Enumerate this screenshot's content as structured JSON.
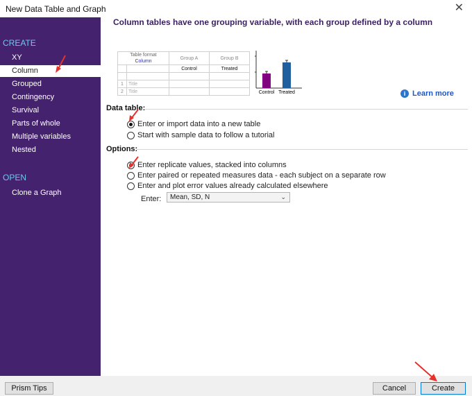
{
  "window": {
    "title": "New Data Table and Graph",
    "close_glyph": "✕"
  },
  "sidebar": {
    "create_header": "CREATE",
    "create_items": [
      {
        "label": "XY"
      },
      {
        "label": "Column"
      },
      {
        "label": "Grouped"
      },
      {
        "label": "Contingency"
      },
      {
        "label": "Survival"
      },
      {
        "label": "Parts of whole"
      },
      {
        "label": "Multiple variables"
      },
      {
        "label": "Nested"
      }
    ],
    "selected_item": "Column",
    "open_header": "OPEN",
    "open_items": [
      {
        "label": "Clone a Graph"
      }
    ]
  },
  "main": {
    "heading": "Column tables have one grouping variable, with each group defined by a column",
    "format_table": {
      "format_label": "Table format",
      "format_value": "Column",
      "group_a_label": "Group A",
      "group_a_name": "Control",
      "group_b_label": "Group B",
      "group_b_name": "Treated",
      "rows": [
        {
          "num": "1",
          "title": "Title"
        },
        {
          "num": "2",
          "title": "Title"
        }
      ]
    },
    "preview_chart": {
      "categories": [
        "Control",
        "Treated"
      ],
      "colors": [
        "#800080",
        "#1f5fa0"
      ]
    },
    "learn_more": {
      "icon": "info-icon",
      "label": "Learn more"
    },
    "data_table": {
      "label": "Data table:",
      "options": [
        {
          "label": "Enter or import data into a new table",
          "checked": true
        },
        {
          "label": "Start with sample data to follow a tutorial",
          "checked": false
        }
      ]
    },
    "options": {
      "label": "Options:",
      "items": [
        {
          "label": "Enter replicate values, stacked into columns",
          "checked": true
        },
        {
          "label": "Enter paired or repeated measures data - each subject on a separate row",
          "checked": false
        },
        {
          "label": "Enter and plot error values already calculated elsewhere",
          "checked": false
        }
      ],
      "enter_label": "Enter:",
      "enter_value": "Mean, SD, N"
    }
  },
  "footer": {
    "tips_button": "Prism Tips",
    "cancel_button": "Cancel",
    "create_button": "Create"
  },
  "colors": {
    "sidebar_bg": "#44226e",
    "sidebar_header": "#6fc7f2",
    "heading": "#3b1f63",
    "annotation_arrow": "#e5322d"
  }
}
